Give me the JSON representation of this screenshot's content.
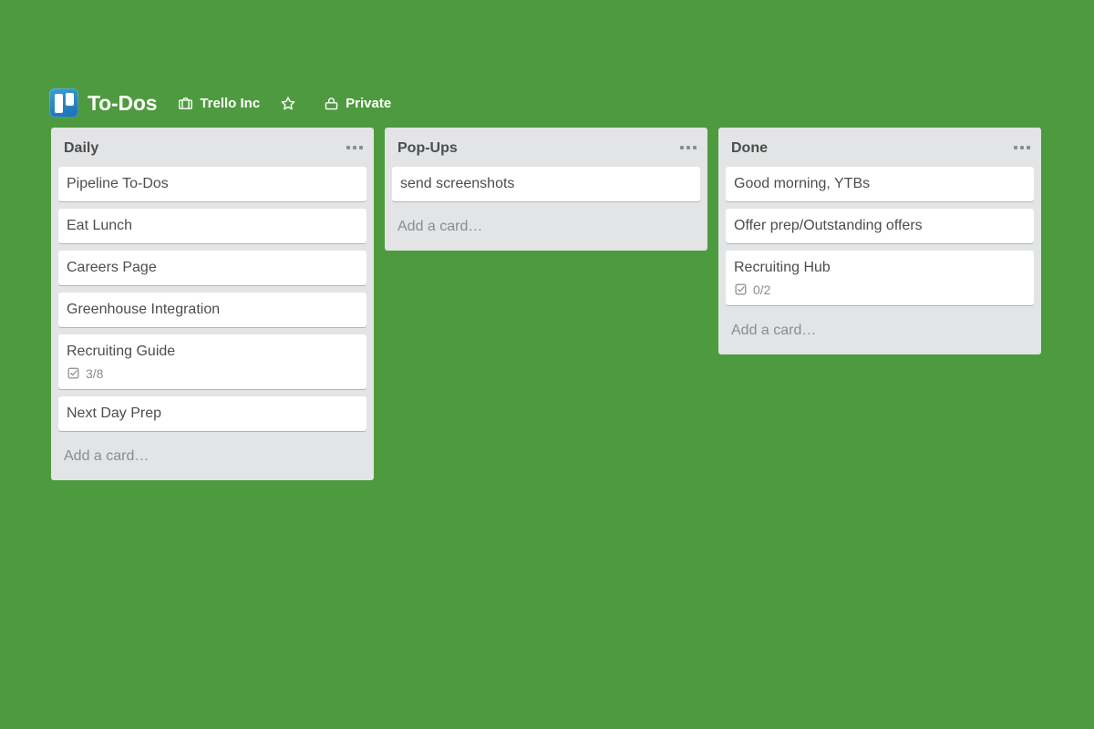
{
  "board": {
    "logo_icon": "trello-logo-icon",
    "title": "To-Dos",
    "header_items": [
      {
        "icon": "briefcase-icon",
        "label": "Trello Inc"
      },
      {
        "icon": "star-icon",
        "label": ""
      },
      {
        "icon": "lock-icon",
        "label": "Private"
      }
    ],
    "colors": {
      "background": "#4e9a3f",
      "list_background": "#e2e4e6",
      "card_background": "#ffffff",
      "text": "#4d4d4d",
      "muted_text": "#8c8c8c",
      "logo_blue": "#2a7fb8"
    }
  },
  "lists": [
    {
      "title": "Daily",
      "menu_icon": "list-menu-icon",
      "add_card_label": "Add a card…",
      "cards": [
        {
          "title": "Pipeline To-Dos"
        },
        {
          "title": "Eat Lunch"
        },
        {
          "title": "Careers Page"
        },
        {
          "title": "Greenhouse Integration"
        },
        {
          "title": "Recruiting Guide",
          "checklist": "3/8",
          "checklist_icon": "checklist-icon"
        },
        {
          "title": "Next Day Prep"
        }
      ]
    },
    {
      "title": "Pop-Ups",
      "menu_icon": "list-menu-icon",
      "add_card_label": "Add a card…",
      "cards": [
        {
          "title": "send screenshots"
        }
      ]
    },
    {
      "title": "Done",
      "menu_icon": "list-menu-icon",
      "add_card_label": "Add a card…",
      "cards": [
        {
          "title": "Good morning, YTBs"
        },
        {
          "title": "Offer prep/Outstanding offers"
        },
        {
          "title": "Recruiting Hub",
          "checklist": "0/2",
          "checklist_icon": "checklist-icon"
        }
      ]
    }
  ]
}
